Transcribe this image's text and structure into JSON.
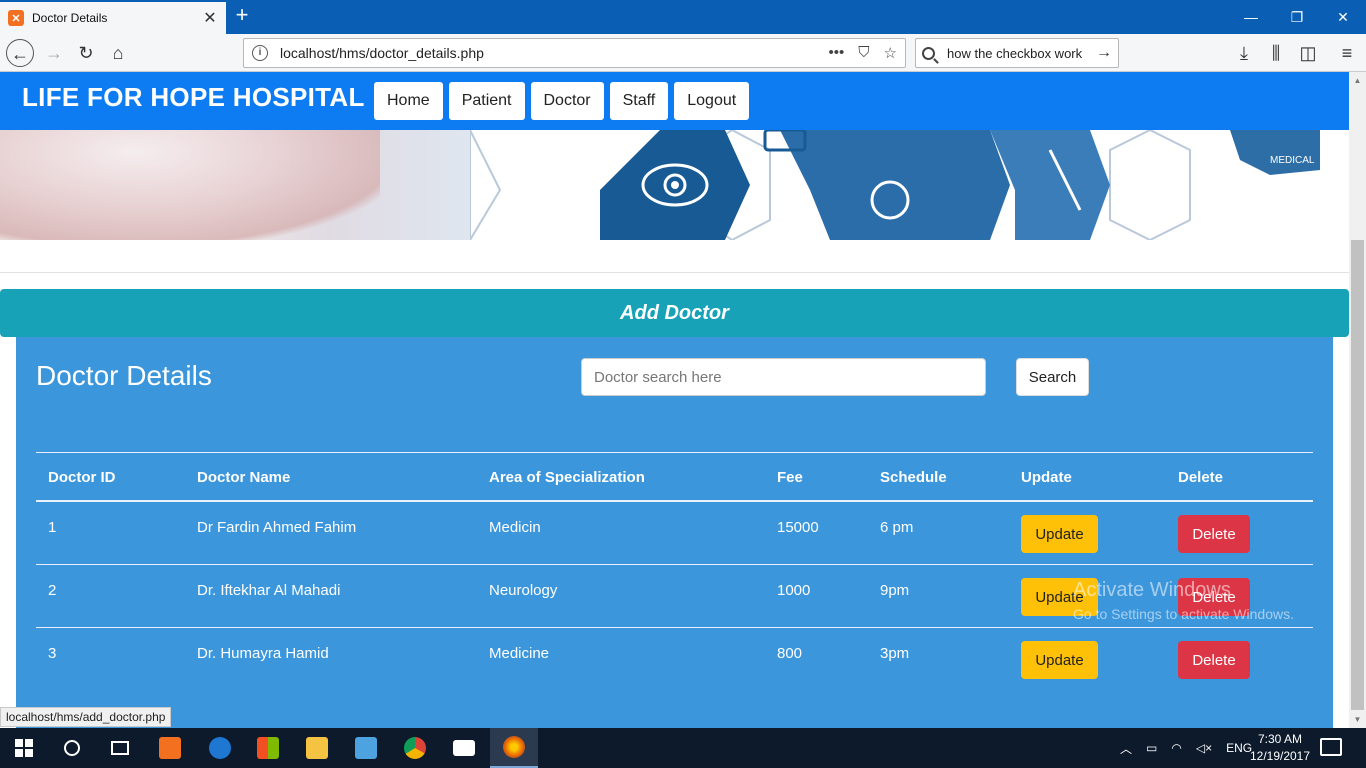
{
  "browser": {
    "tab_title": "Doctor Details",
    "tab_favicon": "xampp-icon",
    "url": "localhost/hms/doctor_details.php",
    "search_text": "how the checkbox work",
    "status_url": "localhost/hms/add_doctor.php"
  },
  "site": {
    "brand": "LIFE FOR HOPE HOSPITAL",
    "menu": [
      "Home",
      "Patient",
      "Doctor",
      "Staff",
      "Logout"
    ],
    "banner_text": "MEDICAL"
  },
  "add_doctor_label": "Add Doctor",
  "panel": {
    "title": "Doctor Details",
    "search_placeholder": "Doctor search here",
    "search_button": "Search"
  },
  "table": {
    "headers": [
      "Doctor ID",
      "Doctor Name",
      "Area of Specialization",
      "Fee",
      "Schedule",
      "Update",
      "Delete"
    ],
    "rows": [
      {
        "id": "1",
        "name": "Dr Fardin Ahmed Fahim",
        "area": "Medicin",
        "fee": "15000",
        "schedule": "6 pm"
      },
      {
        "id": "2",
        "name": "Dr. Iftekhar Al Mahadi",
        "area": "Neurology",
        "fee": "1000",
        "schedule": "9pm"
      },
      {
        "id": "3",
        "name": "Dr. Humayra Hamid",
        "area": "Medicine",
        "fee": "800",
        "schedule": "3pm"
      }
    ],
    "update_label": "Update",
    "delete_label": "Delete"
  },
  "watermark": {
    "line1": "Activate Windows",
    "line2": "Go to Settings to activate Windows."
  },
  "taskbar": {
    "lang": "ENG",
    "time": "7:30 AM",
    "date": "12/19/2017"
  },
  "colors": {
    "header_blue": "#0d7cf2",
    "add_bar_teal": "#17a2b8",
    "panel_blue": "#3b96dc",
    "update_yellow": "#ffc107",
    "delete_red": "#dc3545"
  }
}
